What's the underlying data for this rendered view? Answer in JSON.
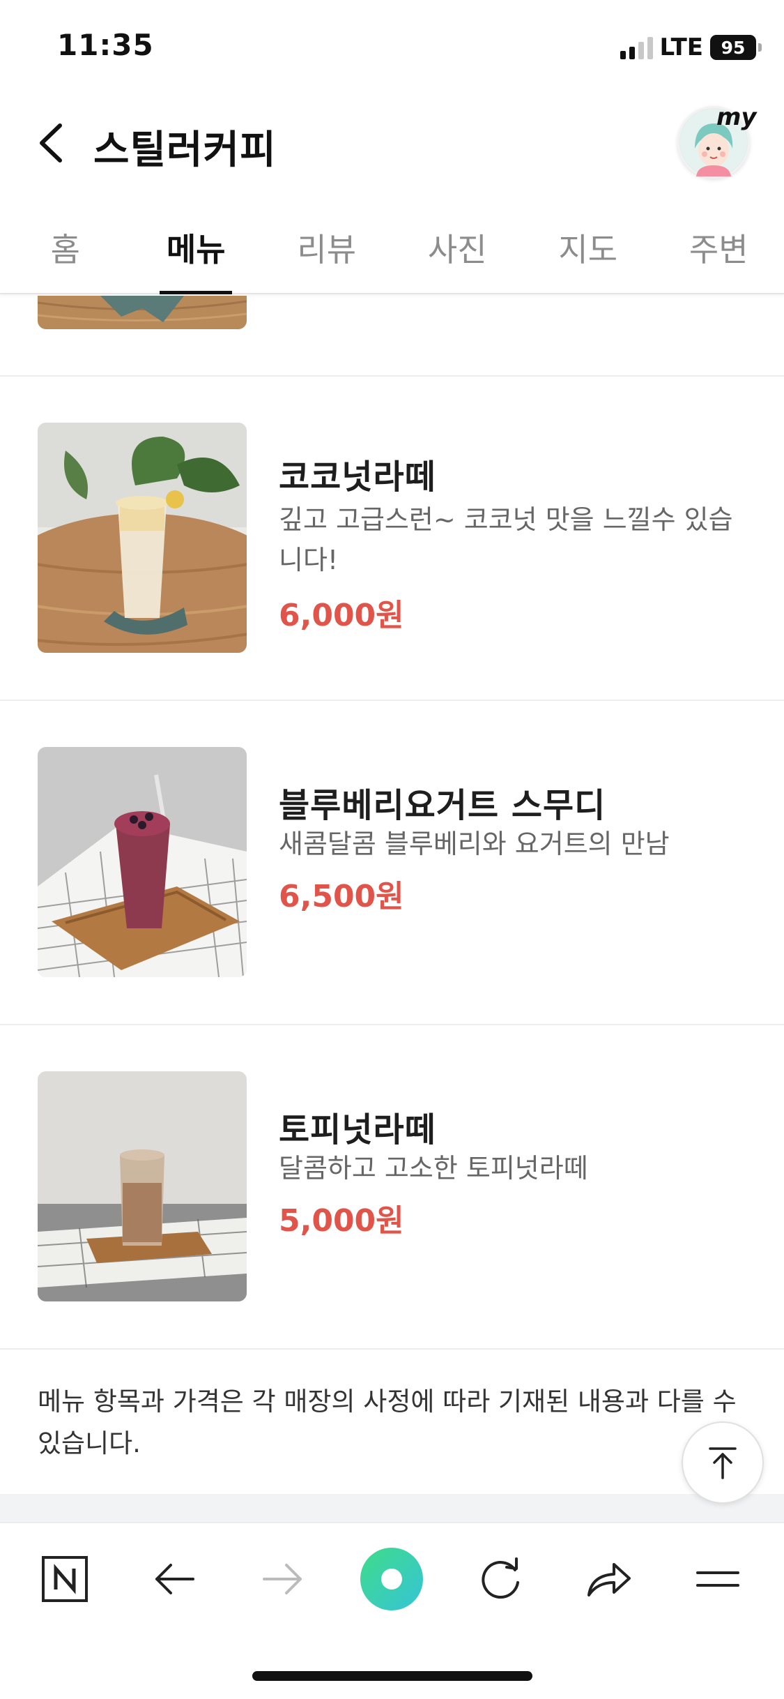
{
  "status_bar": {
    "time": "11:35",
    "network": "LTE",
    "battery": "95"
  },
  "header": {
    "title": "스틸러커피",
    "my_label": "my"
  },
  "tabs": [
    {
      "label": "홈"
    },
    {
      "label": "메뉴",
      "active": true
    },
    {
      "label": "리뷰"
    },
    {
      "label": "사진"
    },
    {
      "label": "지도"
    },
    {
      "label": "주변"
    }
  ],
  "menu_items": [
    {
      "name": "코코넛라떼",
      "description": "깊고 고급스런~ 코코넛 맛을 느낄수 있습니다!",
      "price": "6,000원",
      "image_icon": "coconut-latte-photo"
    },
    {
      "name": "블루베리요거트 스무디",
      "description": "새콤달콤 블루베리와 요거트의 만남",
      "price": "6,500원",
      "image_icon": "blueberry-smoothie-photo"
    },
    {
      "name": "토피넛라떼",
      "description": "달콤하고 고소한 토피넛라떼",
      "price": "5,000원",
      "image_icon": "toffee-nut-latte-photo"
    }
  ],
  "notice": "메뉴 항목과 가격은 각 매장의 사정에 따라 기재된 내용과 다를 수 있습니다.",
  "toolbar": {
    "icons": [
      "naver-logo-icon",
      "back-arrow-icon",
      "forward-arrow-icon",
      "green-dot-icon",
      "refresh-icon",
      "share-icon",
      "menu-icon"
    ]
  },
  "colors": {
    "price": "#e0544a",
    "accent_green": "#3fd6a0"
  }
}
